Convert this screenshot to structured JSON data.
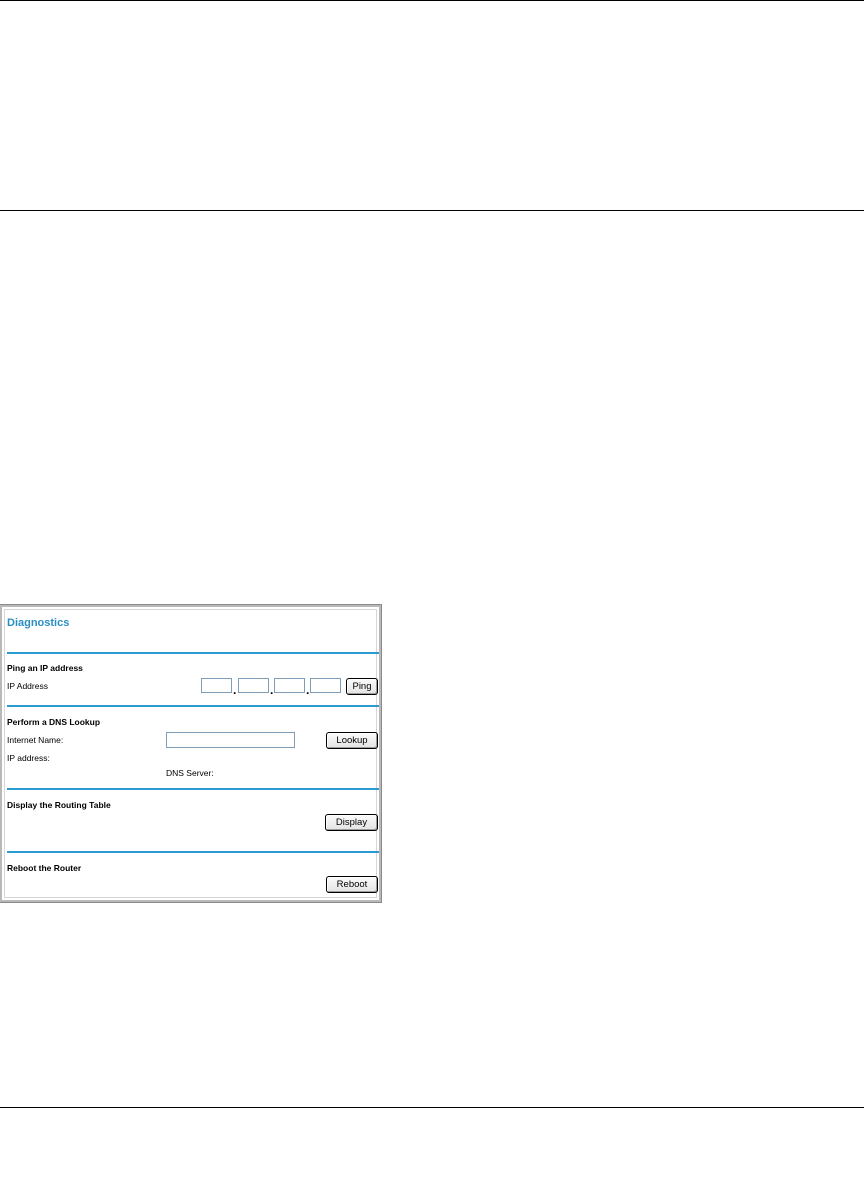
{
  "panel": {
    "title": "Diagnostics",
    "ping": {
      "heading": "Ping an IP address",
      "ip_label": "IP Address",
      "octets": [
        "",
        "",
        "",
        ""
      ],
      "separator": ".",
      "button_label": "Ping"
    },
    "dns": {
      "heading": "Perform a DNS Lookup",
      "name_label": "Internet Name:",
      "name_value": "",
      "button_label": "Lookup",
      "ip_label": "IP address:",
      "server_label": "DNS Server:"
    },
    "routing": {
      "heading": "Display the Routing Table",
      "button_label": "Display"
    },
    "reboot": {
      "heading": "Reboot the Router",
      "button_label": "Reboot"
    },
    "accent_color": "#2a9bd0",
    "title_color": "#2a8ec4"
  }
}
